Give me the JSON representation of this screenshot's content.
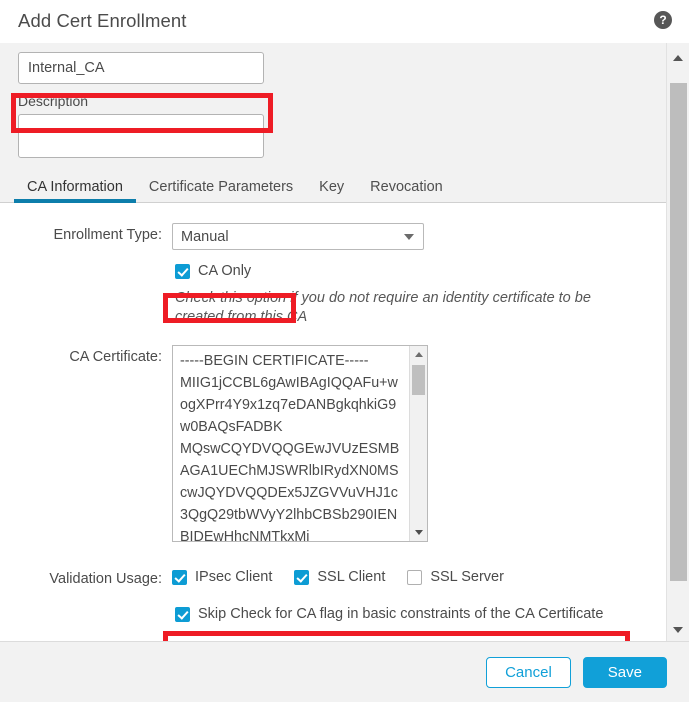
{
  "dialog": {
    "title": "Add Cert Enrollment",
    "help_icon_label": "?"
  },
  "header": {
    "name_value": "Internal_CA",
    "description_label": "Description",
    "description_value": ""
  },
  "tabs": [
    {
      "label": "CA Information",
      "active": true
    },
    {
      "label": "Certificate Parameters",
      "active": false
    },
    {
      "label": "Key",
      "active": false
    },
    {
      "label": "Revocation",
      "active": false
    }
  ],
  "ca_information": {
    "enrollment_type_label": "Enrollment Type:",
    "enrollment_type_value": "Manual",
    "ca_only_label": "CA Only",
    "ca_only_checked": true,
    "hint_text": "Check this option if you do not require an identity certificate to be created from this CA",
    "ca_certificate_label": "CA Certificate:",
    "ca_certificate_value": "-----BEGIN CERTIFICATE-----\nMIIG1jCCBL6gAwIBAgIQQAFu+wogXPrr4Y9x1zq7eDANBgkqhkiG9w0BAQsFADBK\nMQswCQYDVQQGEwJVUzESMBAGA1UEChMJSWRlbIRydXN0MScwJQYDVQQDEx5JZGVVuVHJ1c3QgQ29tbWVyY2lhbCBSb290IENBIDEwHhcNMTkxMj",
    "validation_usage_label": "Validation Usage:",
    "validation_usage": [
      {
        "label": "IPsec Client",
        "checked": true
      },
      {
        "label": "SSL Client",
        "checked": true
      },
      {
        "label": "SSL Server",
        "checked": false
      }
    ],
    "skip_check_label": "Skip Check for CA flag in basic constraints of the CA Certificate",
    "skip_check_checked": true
  },
  "footer": {
    "cancel_label": "Cancel",
    "save_label": "Save"
  },
  "colors": {
    "accent": "#11a0d8",
    "tab_indicator": "#0d7eab",
    "checkbox_checked": "#0d9cd4",
    "annotation_red": "#ee1c25",
    "panel_bg": "#ffffff",
    "chrome_bg": "#f2f2f2"
  }
}
